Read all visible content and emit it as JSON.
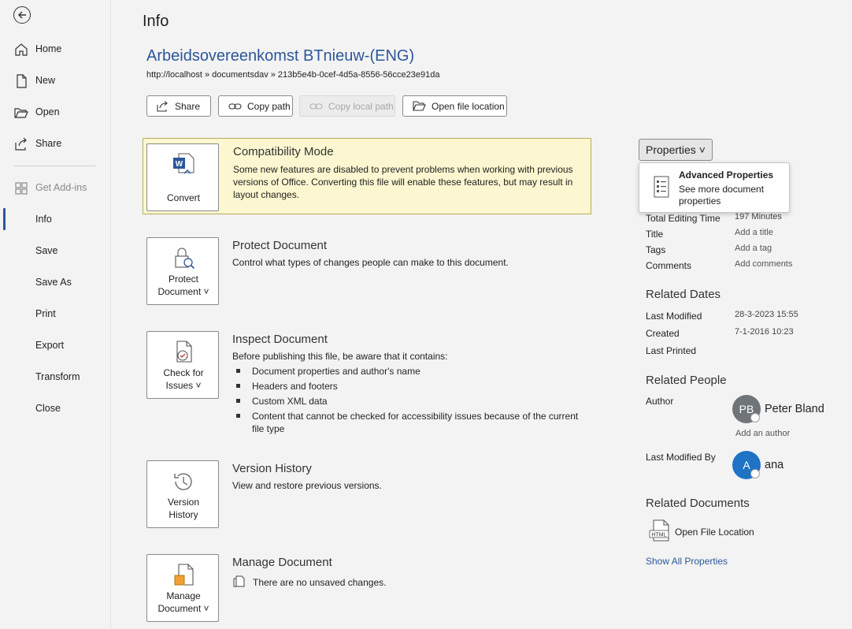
{
  "sidebar": {
    "items": [
      {
        "label": "Home"
      },
      {
        "label": "New"
      },
      {
        "label": "Open"
      },
      {
        "label": "Share"
      },
      {
        "label": "Get Add-ins"
      },
      {
        "label": "Info"
      },
      {
        "label": "Save"
      },
      {
        "label": "Save As"
      },
      {
        "label": "Print"
      },
      {
        "label": "Export"
      },
      {
        "label": "Transform"
      },
      {
        "label": "Close"
      }
    ],
    "active": "Info"
  },
  "header": {
    "page_title": "Info",
    "doc_title": "Arbeidsovereenkomst BTnieuw-(ENG)",
    "doc_path": "http://localhost » documentsdav » 213b5e4b-0cef-4d5a-8556-56cce23e91da"
  },
  "toolbar": {
    "share": "Share",
    "copy_path": "Copy path",
    "copy_local_path": "Copy local path",
    "open_location": "Open file location"
  },
  "sections": {
    "compat": {
      "tile": "Convert",
      "title": "Compatibility Mode",
      "desc": "Some new features are disabled to prevent problems when working with previous versions of Office. Converting this file will enable these features, but may result in layout changes."
    },
    "protect": {
      "tile_line1": "Protect",
      "tile_line2": "Document ˅",
      "title": "Protect Document",
      "desc": "Control what types of changes people can make to this document."
    },
    "inspect": {
      "tile_line1": "Check for",
      "tile_line2": "Issues ˅",
      "title": "Inspect Document",
      "desc": "Before publishing this file, be aware that it contains:",
      "bullets": [
        "Document properties and author's name",
        "Headers and footers",
        "Custom XML data",
        "Content that cannot be checked for accessibility issues because of the current file type"
      ]
    },
    "version": {
      "tile_line1": "Version",
      "tile_line2": "History",
      "title": "Version History",
      "desc": "View and restore previous versions."
    },
    "manage": {
      "tile_line1": "Manage",
      "tile_line2": "Document ˅",
      "title": "Manage Document",
      "desc": "There are no unsaved changes."
    }
  },
  "properties": {
    "button": "Properties ˅",
    "menu": {
      "title": "Advanced Properties",
      "desc": "See more document properties"
    },
    "rows": [
      {
        "label": "Total Editing Time",
        "value": "197 Minutes"
      },
      {
        "label": "Title",
        "value": "Add a title"
      },
      {
        "label": "Tags",
        "value": "Add a tag"
      },
      {
        "label": "Comments",
        "value": "Add comments"
      }
    ]
  },
  "related_dates": {
    "heading": "Related Dates",
    "rows": [
      {
        "label": "Last Modified",
        "value": "28-3-2023 15:55"
      },
      {
        "label": "Created",
        "value": "7-1-2016 10:23"
      },
      {
        "label": "Last Printed",
        "value": ""
      }
    ]
  },
  "related_people": {
    "heading": "Related People",
    "author_label": "Author",
    "author_initials": "PB",
    "author_name": "Peter Bland",
    "add_author": "Add an author",
    "last_modified_label": "Last Modified By",
    "modifier_initials": "A",
    "modifier_name": "ana"
  },
  "related_docs": {
    "heading": "Related Documents",
    "open_location": "Open File Location",
    "html_badge": "HTML",
    "show_all": "Show All Properties"
  },
  "colors": {
    "accent": "#2b579a",
    "compat_bg": "#fcf7d0",
    "author_avatar": "#6f7479",
    "modifier_avatar": "#1e73c6"
  }
}
